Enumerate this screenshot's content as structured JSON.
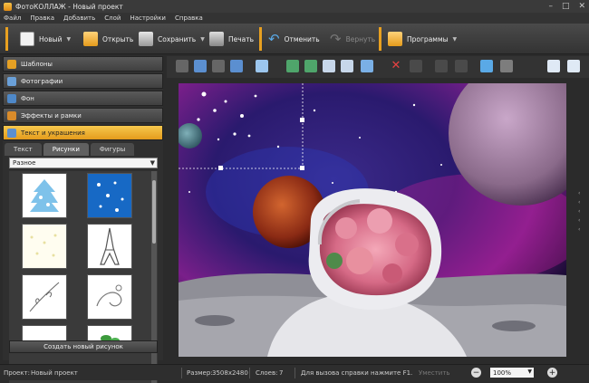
{
  "window": {
    "title": "ФотоКОЛЛАЖ - Новый проект",
    "controls": [
      "–",
      "□",
      "✕"
    ]
  },
  "menu": [
    "Файл",
    "Правка",
    "Добавить",
    "Слой",
    "Настройки",
    "Справка"
  ],
  "toolbar": {
    "new_label": "Новый",
    "open_label": "Открыть",
    "save_label": "Сохранить",
    "print_label": "Печать",
    "undo_label": "Отменить",
    "redo_label": "Вернуть",
    "programs_label": "Программы"
  },
  "sidebar": {
    "items": [
      {
        "label": "Шаблоны",
        "active": false
      },
      {
        "label": "Фотографии",
        "active": false
      },
      {
        "label": "Фон",
        "active": false
      },
      {
        "label": "Эффекты и рамки",
        "active": false
      },
      {
        "label": "Текст и украшения",
        "active": true
      }
    ],
    "tabs": [
      "Текст",
      "Рисунки",
      "Фигуры"
    ],
    "active_tab": "Рисунки",
    "category_value": "Разное",
    "create_button": "Создать новый рисунок"
  },
  "status": {
    "project_label": "Проект:",
    "project_value": "Новый проект",
    "size_label": "Размер:",
    "size_value": "3508x2480",
    "layers_label": "Слоев:",
    "layers_value": "7",
    "help_text": "Для вызова справки нажмите F1.",
    "fit_label": "Уместить",
    "zoom_value": "100%"
  },
  "colors": {
    "accent": "#e8a020",
    "active_item": "#f4b93a"
  }
}
